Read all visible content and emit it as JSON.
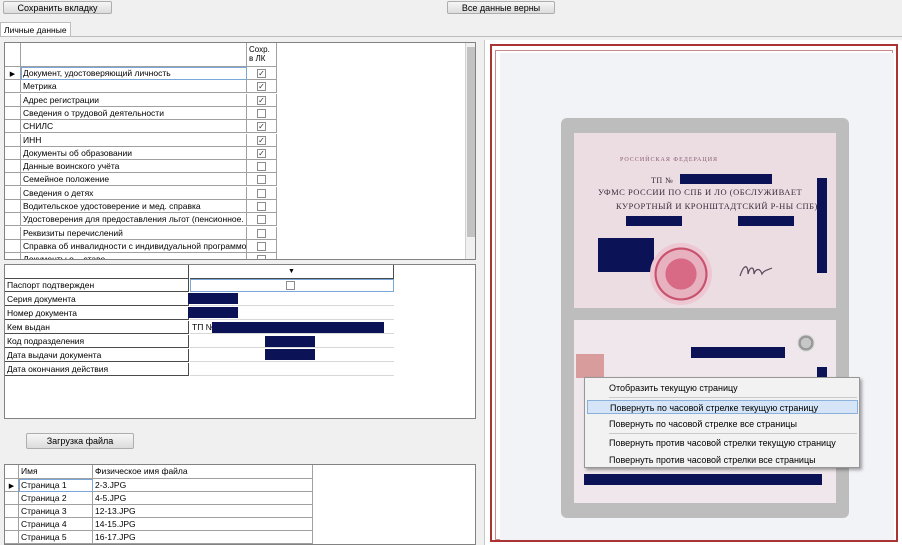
{
  "toolbar": {
    "save_tab_label": "Сохранить вкладку",
    "all_ok_label": "Все данные верны"
  },
  "tabs": [
    {
      "label": "Личные данные"
    }
  ],
  "documents": {
    "col_saved_header": "Сохр. в ЛК",
    "rows": [
      {
        "name": "Документ, удостоверяющий личность",
        "saved": true,
        "current": true
      },
      {
        "name": "Метрика",
        "saved": true
      },
      {
        "name": "Адрес регистрации",
        "saved": true
      },
      {
        "name": "Сведения о трудовой деятельности",
        "saved": false
      },
      {
        "name": "СНИЛС",
        "saved": true
      },
      {
        "name": "ИНН",
        "saved": true
      },
      {
        "name": "Документы об образовании",
        "saved": true
      },
      {
        "name": "Данные воинского учёта",
        "saved": false
      },
      {
        "name": "Семейное положение",
        "saved": false
      },
      {
        "name": "Сведения о детях",
        "saved": false
      },
      {
        "name": "Водительское удостоверение и мед. справка",
        "saved": false
      },
      {
        "name": "Удостоверения для предоставления льгот (пенсионное.",
        "saved": false
      },
      {
        "name": "Реквизиты перечислений",
        "saved": false
      },
      {
        "name": "Справка об инвалидности с индивидуальной программо",
        "saved": false
      },
      {
        "name": "Документы о ...ставе...",
        "saved": false
      }
    ]
  },
  "properties": {
    "dropdown_arrow": "▼",
    "rows": [
      {
        "label": "Паспорт подтвержден",
        "value": "",
        "checkbox": true
      },
      {
        "label": "Серия документа",
        "value": ""
      },
      {
        "label": "Номер документа",
        "value": ""
      },
      {
        "label": "Кем выдан",
        "value": "ТП №"
      },
      {
        "label": "Код подразделения",
        "value": ""
      },
      {
        "label": "Дата выдачи документа",
        "value": ""
      },
      {
        "label": "Дата окончания действия",
        "value": ""
      }
    ]
  },
  "upload_label": "Загрузка файла",
  "files": {
    "headers": {
      "name": "Имя",
      "physical": "Физическое имя файла"
    },
    "rows": [
      {
        "name": "Страница 1",
        "file": "2-3.JPG",
        "current": true
      },
      {
        "name": "Страница 2",
        "file": "4-5.JPG"
      },
      {
        "name": "Страница 3",
        "file": "12-13.JPG"
      },
      {
        "name": "Страница 4",
        "file": "14-15.JPG"
      },
      {
        "name": "Страница 5",
        "file": "16-17.JPG"
      }
    ]
  },
  "passport_scan": {
    "header": "РОССИЙСКАЯ ФЕДЕРАЦИЯ",
    "tp": "ТП №",
    "line1": "УФМС РОССИИ ПО СПБ И ЛО (ОБСЛУЖИВАЕТ",
    "line2": "КУРОРТНЫЙ И КРОНШТАДТСКИЙ Р-НЫ СПБ)"
  },
  "context_menu": {
    "items": [
      {
        "label": "Отобразить текущую страницу"
      },
      {
        "label": "Повернуть по часовой стрелке текущую страницу",
        "highlighted": true
      },
      {
        "label": "Повернуть по часовой стрелке все страницы"
      },
      {
        "label": "Повернуть против часовой стрелки текущую страницу"
      },
      {
        "label": "Повернуть против часовой стрелки все страницы"
      }
    ]
  },
  "colors": {
    "redaction": "#0b1356",
    "frame": "#aa3333",
    "menu_highlight": "#d5e5f7"
  }
}
